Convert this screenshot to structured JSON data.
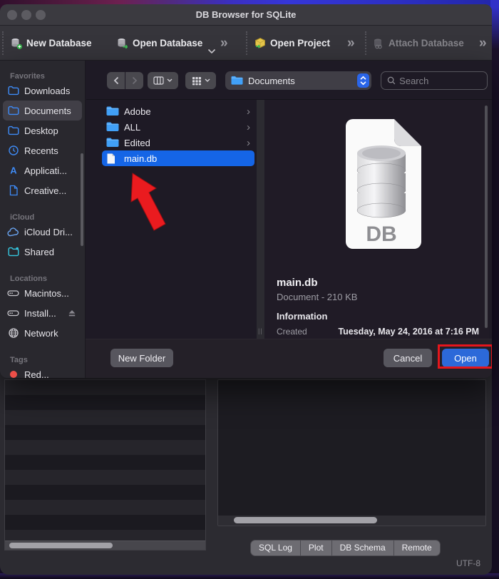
{
  "titlebar": {
    "title": "DB Browser for SQLite"
  },
  "toolbar": {
    "items": [
      {
        "label": "New Database",
        "icon": "db-new-icon",
        "disabled": false
      },
      {
        "label": "Open Database",
        "icon": "db-open-icon",
        "disabled": false
      },
      {
        "label": "Open Project",
        "icon": "project-open-icon",
        "disabled": false
      },
      {
        "label": "Attach Database",
        "icon": "db-attach-icon",
        "disabled": true
      }
    ],
    "overflow_glyph": "»"
  },
  "dialog": {
    "sidebar": {
      "sections": [
        {
          "header": "Favorites",
          "items": [
            {
              "label": "Downloads",
              "icon": "folder"
            },
            {
              "label": "Documents",
              "icon": "folder",
              "selected": true
            },
            {
              "label": "Desktop",
              "icon": "folder"
            },
            {
              "label": "Recents",
              "icon": "clock"
            },
            {
              "label": "Applicati...",
              "icon": "app"
            },
            {
              "label": "Creative...",
              "icon": "doc"
            }
          ]
        },
        {
          "header": "iCloud",
          "items": [
            {
              "label": "iCloud Dri...",
              "icon": "cloud"
            },
            {
              "label": "Shared",
              "icon": "shared"
            }
          ]
        },
        {
          "header": "Locations",
          "items": [
            {
              "label": "Macintos...",
              "icon": "drive"
            },
            {
              "label": "Install...",
              "icon": "drive",
              "eject": true
            },
            {
              "label": "Network",
              "icon": "globe"
            }
          ]
        },
        {
          "header": "Tags",
          "items": [
            {
              "label": "Red...",
              "icon": "tag-red"
            }
          ]
        }
      ]
    },
    "nav": {
      "path_label": "Documents",
      "search_placeholder": "Search"
    },
    "files": [
      {
        "name": "Adobe",
        "icon": "folder",
        "chevron": true
      },
      {
        "name": "ALL",
        "icon": "folder",
        "chevron": true
      },
      {
        "name": "Edited",
        "icon": "folder",
        "chevron": true
      },
      {
        "name": "main.db",
        "icon": "file",
        "selected": true
      }
    ],
    "preview": {
      "badge": "DB",
      "name": "main.db",
      "kind": "Document - 210 KB",
      "info_header": "Information",
      "created_label": "Created",
      "created_value": "Tuesday, May 24, 2016 at 7:16 PM"
    },
    "footer": {
      "new_folder": "New Folder",
      "cancel": "Cancel",
      "open": "Open"
    }
  },
  "bottom": {
    "tabs": [
      "SQL Log",
      "Plot",
      "DB Schema",
      "Remote"
    ],
    "encoding": "UTF-8"
  },
  "colors": {
    "selection_blue": "#1565e6",
    "open_button_blue": "#2c69d9",
    "annotation_red": "#e5161c",
    "folder_blue": "#41a0f7"
  }
}
